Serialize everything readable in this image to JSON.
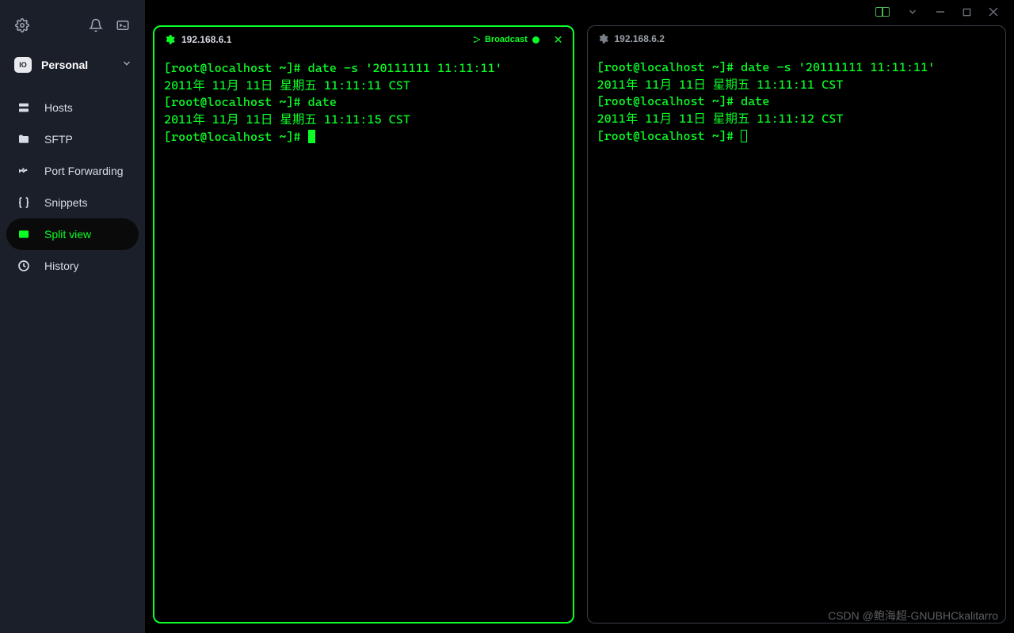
{
  "sidebar": {
    "personal": {
      "label": "Personal",
      "badge": "IO"
    },
    "items": [
      {
        "label": "Hosts",
        "icon": "server-icon"
      },
      {
        "label": "SFTP",
        "icon": "folder-icon"
      },
      {
        "label": "Port Forwarding",
        "icon": "forward-icon"
      },
      {
        "label": "Snippets",
        "icon": "braces-icon"
      },
      {
        "label": "Split view",
        "icon": "splitview-icon",
        "active": true
      },
      {
        "label": "History",
        "icon": "history-icon"
      }
    ]
  },
  "broadcast_label": "Broadcast",
  "panes": [
    {
      "host": "192.168.6.1",
      "focused": true,
      "has_broadcast": true,
      "lines": [
        "[root@localhost ~]# date -s '20111111 11:11:11'",
        "2011年 11月 11日 星期五 11:11:11 CST",
        "[root@localhost ~]# date",
        "2011年 11月 11日 星期五 11:11:15 CST"
      ],
      "prompt": "[root@localhost ~]# ",
      "cursor": "block"
    },
    {
      "host": "192.168.6.2",
      "focused": false,
      "has_broadcast": false,
      "lines": [
        "[root@localhost ~]# date -s '20111111 11:11:11'",
        "2011年 11月 11日 星期五 11:11:11 CST",
        "[root@localhost ~]# date",
        "2011年 11月 11日 星期五 11:11:12 CST"
      ],
      "prompt": "[root@localhost ~]# ",
      "cursor": "outline"
    }
  ],
  "watermark": "CSDN @鲍海超-GNUBHCkalitarro"
}
